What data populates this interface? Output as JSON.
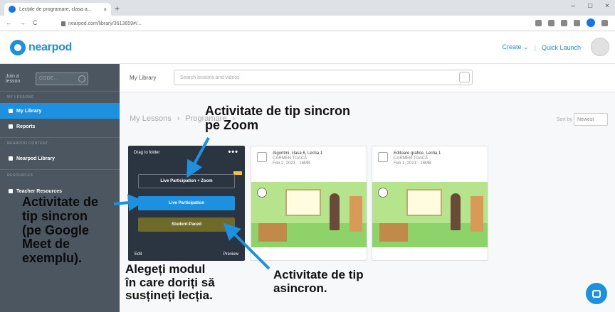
{
  "browser": {
    "tab_title": "Lecţiile de programare, clasa a...",
    "tab_close": "×",
    "new_tab": "+",
    "window_controls": [
      "–",
      "□",
      "×"
    ],
    "nav": [
      "←",
      "→",
      "C"
    ],
    "url": "nearpod.com/library/3613659#/..."
  },
  "nearpod": {
    "logo": "nearpod",
    "create_label": "Create ⌄",
    "quick_launch_label": "Quick Launch"
  },
  "sidebar": {
    "join_label": "Join a lesson",
    "code_placeholder": "CODE...",
    "section_lessons": "MY LESSONS",
    "section_content": "NEARPOD CONTENT",
    "section_resources": "RESOURCES",
    "items": [
      {
        "label": "My Library"
      },
      {
        "label": "Reports"
      },
      {
        "label": "Nearpod Library"
      },
      {
        "label": "Teacher Resources"
      }
    ]
  },
  "main": {
    "library_label": "My Library",
    "search_placeholder": "Search lessons and videos",
    "breadcrumb": [
      "My Lessons",
      "›",
      "Programare",
      "›"
    ],
    "sort_label": "Sort by",
    "sort_value": "Newest"
  },
  "hover_card": {
    "drag_label": "Drag to folder",
    "dots": "•••",
    "zoom_button": "Live Participation + Zoom",
    "live_button": "Live Participation",
    "student_button": "Student-Paced",
    "edit_label": "Edit",
    "preview_label": "Preview"
  },
  "cards": [
    {
      "title": "Algoritmi, clasa 6, Lectia 1",
      "author": "CARMEN TOACĂ",
      "date": "Feb 2, 2021 · 16MB"
    },
    {
      "title": "Editoare grafice, Lectia 1",
      "author": "CARMEN TOACĂ",
      "date": "Feb 1, 2021 · 16MB"
    }
  ],
  "annotations": {
    "top": [
      "Activitate de tip sincron",
      "pe Zoom"
    ],
    "left": [
      "Activitate de",
      "tip sincron",
      "(pe Google",
      "Meet de",
      "exemplu)."
    ],
    "bottom": [
      "Alegeți modul",
      "în care doriți să",
      "susțineți lecția."
    ],
    "right": [
      "Activitate de tip",
      "asincron."
    ]
  },
  "colors": {
    "accent": "#1e90e0",
    "sidebar": "#4b5661",
    "arrow": "#1e90e0"
  }
}
